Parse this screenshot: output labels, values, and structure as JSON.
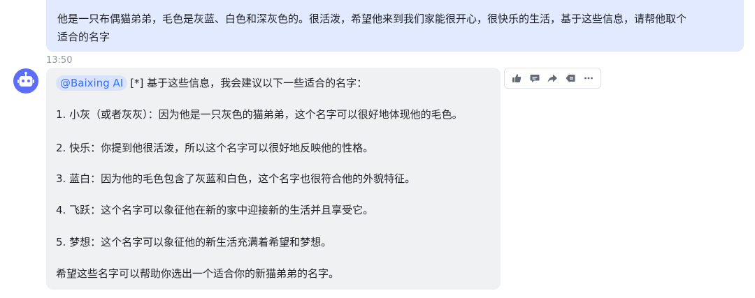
{
  "user_message": {
    "line1": "他是一只布偶猫弟弟，毛色是灰蓝、白色和深灰色的。很活泼，希望他来到我们家能很开心，很快乐的生活，基于这些信息，请帮他取个",
    "line2": "适合的名字"
  },
  "timestamp": "13:50",
  "bot_reply": {
    "mention": "@Baixing AI",
    "intro": "[*] 基于这些信息，我会建议以下一些适合的名字：",
    "items": [
      "1. 小灰（或者灰灰）：因为他是一只灰色的猫弟弟，这个名字可以很好地体现他的毛色。",
      "2. 快乐：你提到他很活泼，所以这个名字可以很好地反映他的性格。",
      "3. 蓝白：因为他的毛色包含了灰蓝和白色，这个名字也很符合他的外貌特征。",
      "4. 飞跃：这个名字可以象征他在新的家中迎接新的生活并且享受它。",
      "5. 梦想：这个名字可以象征他的新生活充满着希望和梦想。"
    ],
    "closing": "希望这些名字可以帮助你选出一个适合你的新猫弟弟的名字。"
  },
  "actions": [
    "thumbs-up-icon",
    "comment-icon",
    "forward-icon",
    "tag-icon",
    "more-icon"
  ],
  "colors": {
    "user_bubble": "#e1eaff",
    "bot_bubble": "#f0f1f3",
    "mention_text": "#3370ff",
    "avatar": "#5b6ef5"
  }
}
